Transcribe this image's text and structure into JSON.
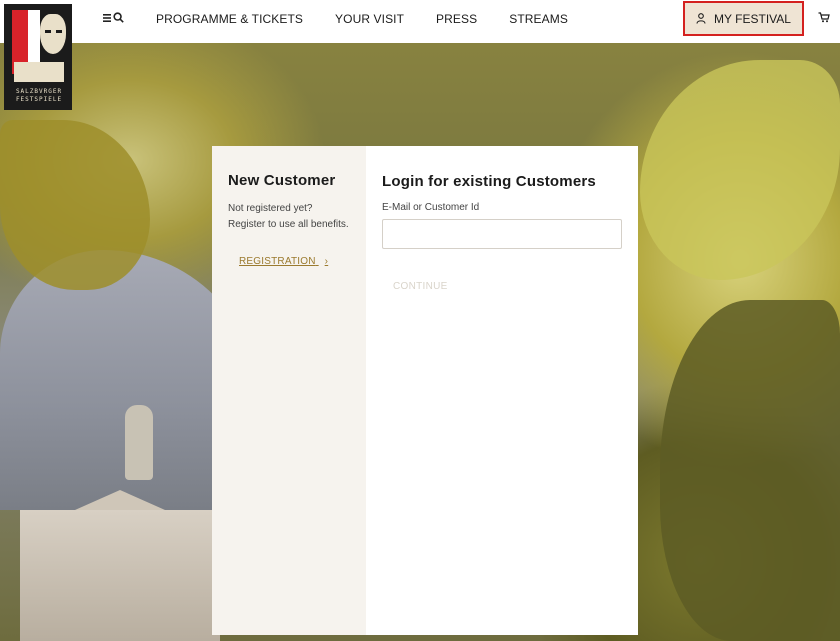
{
  "header": {
    "logo_text": "SALZBVRGER FESTSPIELE",
    "menu_icon": "menu-icon",
    "search_icon": "search-icon",
    "nav": [
      {
        "label": "PROGRAMME & TICKETS"
      },
      {
        "label": "YOUR VISIT"
      },
      {
        "label": "PRESS"
      },
      {
        "label": "STREAMS"
      }
    ],
    "my_festival_label": "MY FESTIVAL",
    "user_icon": "user-icon",
    "cart_icon": "cart-icon"
  },
  "new_customer": {
    "title": "New Customer",
    "text": "Not registered yet? Register to use all benefits.",
    "registration_label": "REGISTRATION",
    "arrow": "›"
  },
  "login": {
    "title": "Login for existing Customers",
    "email_label": "E-Mail or Customer Id",
    "email_value": "",
    "continue_label": "CONTINUE"
  },
  "colors": {
    "accent_gold": "#9b7a2e",
    "highlight_border": "#d4211f",
    "my_festival_bg": "#efe4d4"
  }
}
